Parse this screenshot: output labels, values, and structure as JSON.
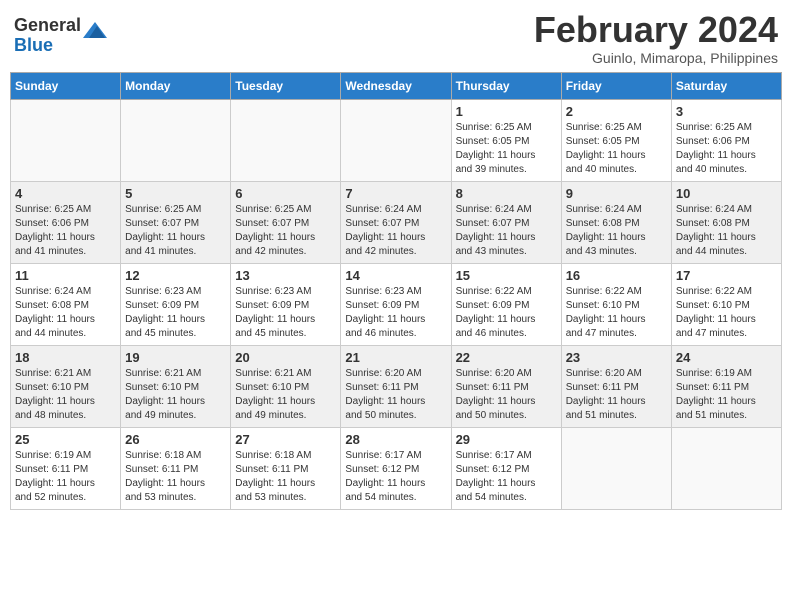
{
  "logo": {
    "general": "General",
    "blue": "Blue"
  },
  "calendar": {
    "title": "February 2024",
    "subtitle": "Guinlo, Mimaropa, Philippines",
    "days_of_week": [
      "Sunday",
      "Monday",
      "Tuesday",
      "Wednesday",
      "Thursday",
      "Friday",
      "Saturday"
    ],
    "weeks": [
      [
        {
          "day": "",
          "info": ""
        },
        {
          "day": "",
          "info": ""
        },
        {
          "day": "",
          "info": ""
        },
        {
          "day": "",
          "info": ""
        },
        {
          "day": "1",
          "info": "Sunrise: 6:25 AM\nSunset: 6:05 PM\nDaylight: 11 hours\nand 39 minutes."
        },
        {
          "day": "2",
          "info": "Sunrise: 6:25 AM\nSunset: 6:05 PM\nDaylight: 11 hours\nand 40 minutes."
        },
        {
          "day": "3",
          "info": "Sunrise: 6:25 AM\nSunset: 6:06 PM\nDaylight: 11 hours\nand 40 minutes."
        }
      ],
      [
        {
          "day": "4",
          "info": "Sunrise: 6:25 AM\nSunset: 6:06 PM\nDaylight: 11 hours\nand 41 minutes."
        },
        {
          "day": "5",
          "info": "Sunrise: 6:25 AM\nSunset: 6:07 PM\nDaylight: 11 hours\nand 41 minutes."
        },
        {
          "day": "6",
          "info": "Sunrise: 6:25 AM\nSunset: 6:07 PM\nDaylight: 11 hours\nand 42 minutes."
        },
        {
          "day": "7",
          "info": "Sunrise: 6:24 AM\nSunset: 6:07 PM\nDaylight: 11 hours\nand 42 minutes."
        },
        {
          "day": "8",
          "info": "Sunrise: 6:24 AM\nSunset: 6:07 PM\nDaylight: 11 hours\nand 43 minutes."
        },
        {
          "day": "9",
          "info": "Sunrise: 6:24 AM\nSunset: 6:08 PM\nDaylight: 11 hours\nand 43 minutes."
        },
        {
          "day": "10",
          "info": "Sunrise: 6:24 AM\nSunset: 6:08 PM\nDaylight: 11 hours\nand 44 minutes."
        }
      ],
      [
        {
          "day": "11",
          "info": "Sunrise: 6:24 AM\nSunset: 6:08 PM\nDaylight: 11 hours\nand 44 minutes."
        },
        {
          "day": "12",
          "info": "Sunrise: 6:23 AM\nSunset: 6:09 PM\nDaylight: 11 hours\nand 45 minutes."
        },
        {
          "day": "13",
          "info": "Sunrise: 6:23 AM\nSunset: 6:09 PM\nDaylight: 11 hours\nand 45 minutes."
        },
        {
          "day": "14",
          "info": "Sunrise: 6:23 AM\nSunset: 6:09 PM\nDaylight: 11 hours\nand 46 minutes."
        },
        {
          "day": "15",
          "info": "Sunrise: 6:22 AM\nSunset: 6:09 PM\nDaylight: 11 hours\nand 46 minutes."
        },
        {
          "day": "16",
          "info": "Sunrise: 6:22 AM\nSunset: 6:10 PM\nDaylight: 11 hours\nand 47 minutes."
        },
        {
          "day": "17",
          "info": "Sunrise: 6:22 AM\nSunset: 6:10 PM\nDaylight: 11 hours\nand 47 minutes."
        }
      ],
      [
        {
          "day": "18",
          "info": "Sunrise: 6:21 AM\nSunset: 6:10 PM\nDaylight: 11 hours\nand 48 minutes."
        },
        {
          "day": "19",
          "info": "Sunrise: 6:21 AM\nSunset: 6:10 PM\nDaylight: 11 hours\nand 49 minutes."
        },
        {
          "day": "20",
          "info": "Sunrise: 6:21 AM\nSunset: 6:10 PM\nDaylight: 11 hours\nand 49 minutes."
        },
        {
          "day": "21",
          "info": "Sunrise: 6:20 AM\nSunset: 6:11 PM\nDaylight: 11 hours\nand 50 minutes."
        },
        {
          "day": "22",
          "info": "Sunrise: 6:20 AM\nSunset: 6:11 PM\nDaylight: 11 hours\nand 50 minutes."
        },
        {
          "day": "23",
          "info": "Sunrise: 6:20 AM\nSunset: 6:11 PM\nDaylight: 11 hours\nand 51 minutes."
        },
        {
          "day": "24",
          "info": "Sunrise: 6:19 AM\nSunset: 6:11 PM\nDaylight: 11 hours\nand 51 minutes."
        }
      ],
      [
        {
          "day": "25",
          "info": "Sunrise: 6:19 AM\nSunset: 6:11 PM\nDaylight: 11 hours\nand 52 minutes."
        },
        {
          "day": "26",
          "info": "Sunrise: 6:18 AM\nSunset: 6:11 PM\nDaylight: 11 hours\nand 53 minutes."
        },
        {
          "day": "27",
          "info": "Sunrise: 6:18 AM\nSunset: 6:11 PM\nDaylight: 11 hours\nand 53 minutes."
        },
        {
          "day": "28",
          "info": "Sunrise: 6:17 AM\nSunset: 6:12 PM\nDaylight: 11 hours\nand 54 minutes."
        },
        {
          "day": "29",
          "info": "Sunrise: 6:17 AM\nSunset: 6:12 PM\nDaylight: 11 hours\nand 54 minutes."
        },
        {
          "day": "",
          "info": ""
        },
        {
          "day": "",
          "info": ""
        }
      ]
    ]
  }
}
